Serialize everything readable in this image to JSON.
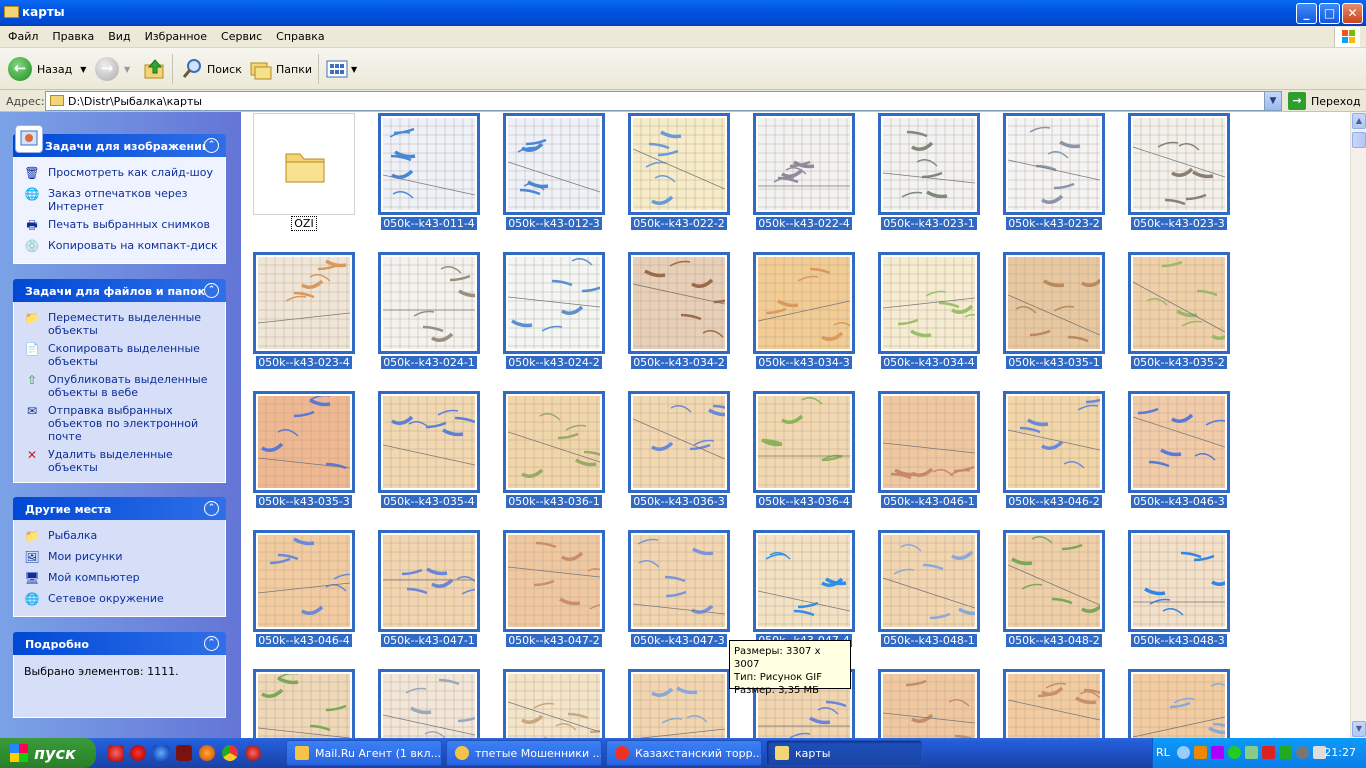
{
  "window": {
    "title": "карты",
    "min": "_",
    "max": "□",
    "close": "✕"
  },
  "menu": [
    "Файл",
    "Правка",
    "Вид",
    "Избранное",
    "Сервис",
    "Справка"
  ],
  "toolbar": {
    "back": "Назад",
    "search": "Поиск",
    "folders": "Папки"
  },
  "address": {
    "label": "Адрес:",
    "value": "D:\\Distr\\Рыбалка\\карты",
    "go": "Переход"
  },
  "left": {
    "image_tasks": {
      "title": "Задачи для изображений",
      "items": [
        "Просмотреть как слайд-шоу",
        "Заказ отпечатков через Интернет",
        "Печать выбранных снимков",
        "Копировать на компакт-диск"
      ]
    },
    "file_tasks": {
      "title": "Задачи для файлов и папок",
      "items": [
        "Переместить выделенные объекты",
        "Скопировать выделенные объекты",
        "Опубликовать выделенные объекты в вебе",
        "Отправка выбранных объектов по электронной почте",
        "Удалить выделенные объекты"
      ]
    },
    "other_places": {
      "title": "Другие места",
      "items": [
        "Рыбалка",
        "Мои рисунки",
        "Мой компьютер",
        "Сетевое окружение"
      ]
    },
    "details": {
      "title": "Подробно",
      "text": "Выбрано элементов: 1111."
    }
  },
  "files": [
    {
      "name": "OZI",
      "type": "folder"
    },
    {
      "name": "050k--k43-011-4",
      "c": "#eef2f8",
      "a": "#4a86d6"
    },
    {
      "name": "050k--k43-012-3",
      "c": "#eef2f8",
      "a": "#4a86d6"
    },
    {
      "name": "050k--k43-022-2",
      "c": "#f6ecc8",
      "a": "#6a9ad8"
    },
    {
      "name": "050k--k43-022-4",
      "c": "#f2f2f2",
      "a": "#8e8a9a"
    },
    {
      "name": "050k--k43-023-1",
      "c": "#f2f2f2",
      "a": "#7d8a7a"
    },
    {
      "name": "050k--k43-023-2",
      "c": "#f4f4f4",
      "a": "#8a96a8"
    },
    {
      "name": "050k--k43-023-3",
      "c": "#f2f0ea",
      "a": "#8a7f72"
    },
    {
      "name": "050k--k43-023-4",
      "c": "#f0e6d8",
      "a": "#d9985c"
    },
    {
      "name": "050k--k43-024-1",
      "c": "#f4f2ee",
      "a": "#9a8e80"
    },
    {
      "name": "050k--k43-024-2",
      "c": "#f4f6f4",
      "a": "#5a8fd0"
    },
    {
      "name": "050k--k43-034-2",
      "c": "#e8d0b8",
      "a": "#9b6a48"
    },
    {
      "name": "050k--k43-034-3",
      "c": "#f2cc92",
      "a": "#d99a5c"
    },
    {
      "name": "050k--k43-034-4",
      "c": "#f6ecd2",
      "a": "#9cbf6a"
    },
    {
      "name": "050k--k43-035-1",
      "c": "#e8c8a0",
      "a": "#b88a5c"
    },
    {
      "name": "050k--k43-035-2",
      "c": "#f0d0a8",
      "a": "#9ab868"
    },
    {
      "name": "050k--k43-035-3",
      "c": "#f0b890",
      "a": "#5a78d6"
    },
    {
      "name": "050k--k43-035-4",
      "c": "#f2d8b0",
      "a": "#5a80d8"
    },
    {
      "name": "050k--k43-036-1",
      "c": "#f0d6a8",
      "a": "#9aa868"
    },
    {
      "name": "050k--k43-036-3",
      "c": "#f2d8b0",
      "a": "#6a8ad8"
    },
    {
      "name": "050k--k43-036-4",
      "c": "#f2d8b0",
      "a": "#8cb25a"
    },
    {
      "name": "050k--k43-046-1",
      "c": "#f0c8a0",
      "a": "#c68a6a"
    },
    {
      "name": "050k--k43-046-2",
      "c": "#f2d6a8",
      "a": "#6a8ad8"
    },
    {
      "name": "050k--k43-046-3",
      "c": "#f2cca8",
      "a": "#5a78d6"
    },
    {
      "name": "050k--k43-046-4",
      "c": "#f2cca0",
      "a": "#6a8ad8"
    },
    {
      "name": "050k--k43-047-1",
      "c": "#f2d6b0",
      "a": "#6a86d8"
    },
    {
      "name": "050k--k43-047-2",
      "c": "#f0c8a0",
      "a": "#c8906a"
    },
    {
      "name": "050k--k43-047-3",
      "c": "#f2d6b0",
      "a": "#7a96d8"
    },
    {
      "name": "050k--k43-047-4",
      "c": "#f4e2c4",
      "a": "#2f8fe8"
    },
    {
      "name": "050k--k43-048-1",
      "c": "#f2d6b0",
      "a": "#8aa8d8"
    },
    {
      "name": "050k--k43-048-2",
      "c": "#f0d0a8",
      "a": "#7aa858"
    },
    {
      "name": "050k--k43-048-3",
      "c": "#f2e0c8",
      "a": "#2f86e6"
    },
    {
      "name": "",
      "c": "#eed8b8",
      "a": "#7aa858"
    },
    {
      "name": "",
      "c": "#f2e6d8",
      "a": "#9aa8b8"
    },
    {
      "name": "",
      "c": "#f4e4c8",
      "a": "#c8a880"
    },
    {
      "name": "",
      "c": "#f2d6b0",
      "a": "#8aa8d8"
    },
    {
      "name": "",
      "c": "#f2d6b0",
      "a": "#6a86d8"
    },
    {
      "name": "",
      "c": "#f0c8a0",
      "a": "#c68a6a"
    },
    {
      "name": "",
      "c": "#f2cca0",
      "a": "#c8906a"
    },
    {
      "name": "",
      "c": "#f2cca0",
      "a": "#8aa8d8"
    }
  ],
  "tooltip": [
    "Размеры: 3307 x 3007",
    "Тип: Рисунок GIF",
    "Размер: 3,35 МБ"
  ],
  "taskbar": {
    "start": "пуск",
    "tasks": [
      "Mail.Ru Агент (1 вкл...",
      "тпетые Мошенники ...",
      "Казахстанский торр...",
      "карты"
    ],
    "lang": "RL",
    "clock": "21:27"
  }
}
